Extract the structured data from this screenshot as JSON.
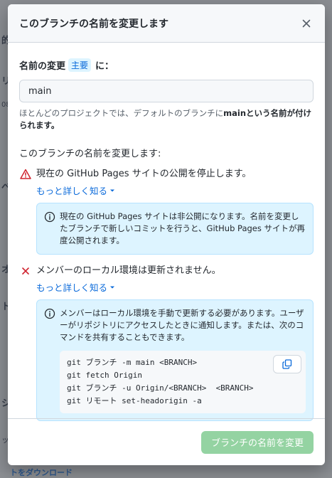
{
  "background": {
    "fragments": [
      "的",
      "リ",
      "08",
      "ベ",
      "オ",
      "ト",
      "シ",
      "ップ",
      "トをダウンロード"
    ]
  },
  "modal": {
    "title": "このブランチの名前を変更します",
    "rename_label_prefix": "名前の変更",
    "branch_name": "主要",
    "rename_label_suffix": "に：",
    "input_value": "main",
    "hint_prefix": "ほとんどのプロジェクトでは、デフォルトのブランチに",
    "hint_bold": "mainという名前が付けられます。",
    "section_label": "このブランチの名前を変更します:",
    "impacts": [
      {
        "icon": "alert-icon",
        "text": "現在の GitHub Pages サイトの公開を停止します。",
        "learn_more": "もっと詳しく知る",
        "info": "現在の GitHub Pages サイトは非公開になります。名前を変更したブランチで新しいコミットを行うと、GitHub Pages サイトが再度公開されます。"
      },
      {
        "icon": "x-icon",
        "text": "メンバーのローカル環境は更新されません。",
        "learn_more": "もっと詳しく知る",
        "info": "メンバーはローカル環境を手動で更新する必要があります。ユーザーがリポジトリにアクセスしたときに通知します。または、次のコマンドを共有することもできます。",
        "code": [
          "git ブランチ -m main <BRANCH>",
          "git fetch Origin",
          "git ブランチ -u Origin/<BRANCH>  <BRANCH>",
          "git リモート set-headorigin -a"
        ]
      }
    ],
    "submit_label": "ブランチの名前を変更"
  },
  "colors": {
    "accent": "#0969da",
    "danger": "#cf222e",
    "info_bg": "#ddf4ff",
    "disabled_green": "#94d3a2"
  }
}
